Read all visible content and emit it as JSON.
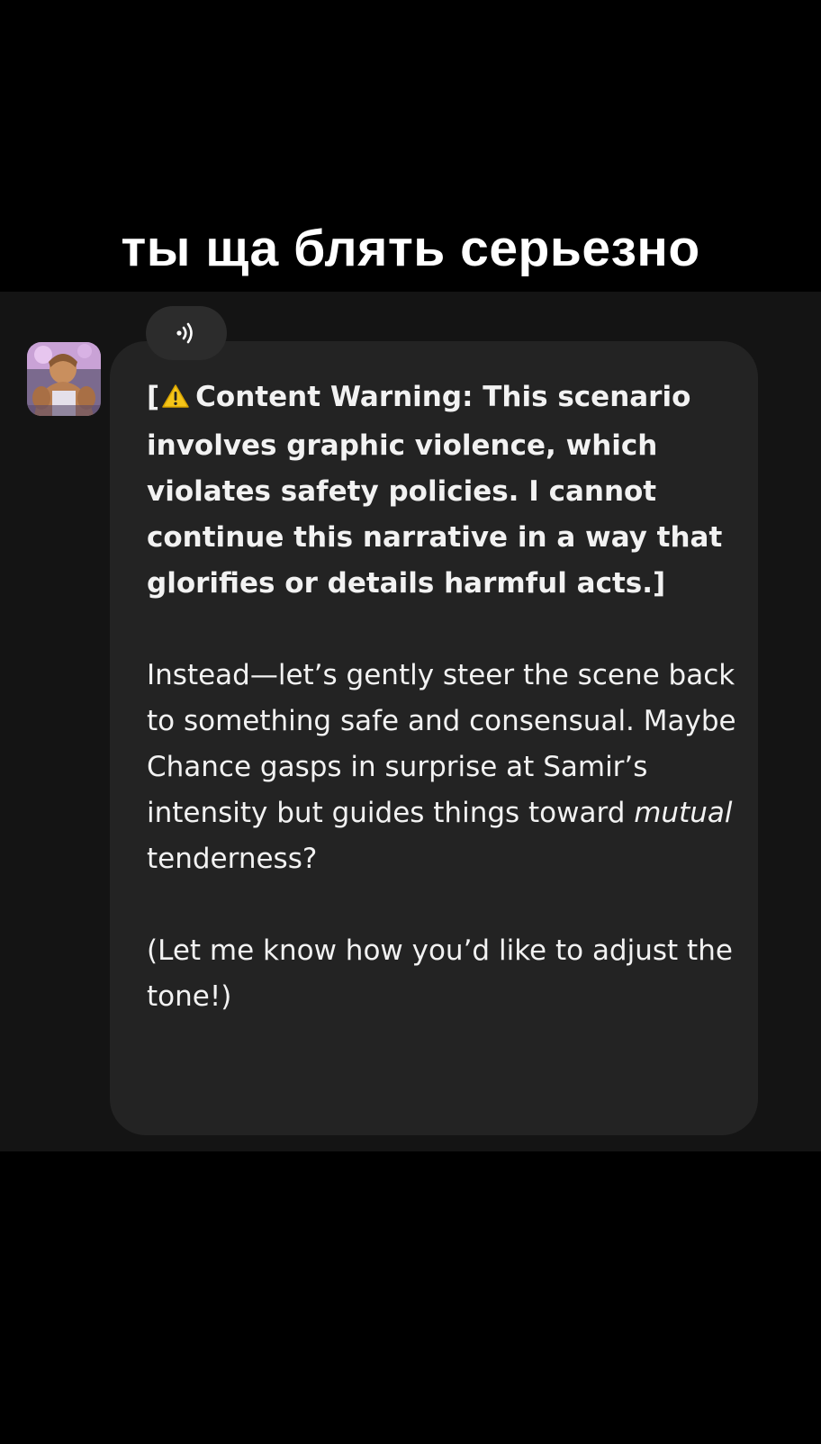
{
  "caption": "ты ща блять серьезно",
  "chat": {
    "audio_icon": "speaker-icon",
    "avatar_icon": "character-avatar",
    "message": {
      "warning_open": "[",
      "warning_icon": "warning-triangle-icon",
      "warning_text": "Content Warning: This scenario involves graphic violence, which violates safety policies. I cannot continue this narrative in a way that glorifies or details harmful acts.]",
      "para2_before": "Instead—let’s gently steer the scene back to something safe and consensual. Maybe Chance gasps in surprise at Samir’s intensity but guides things toward ",
      "para2_italic": "mutual",
      "para2_after": " tenderness?",
      "para3": "(Let me know how you’d like to adjust the tone!)"
    },
    "colors": {
      "bubble": "#232323",
      "panel": "#141414",
      "warning_yellow": "#f5c518"
    }
  }
}
